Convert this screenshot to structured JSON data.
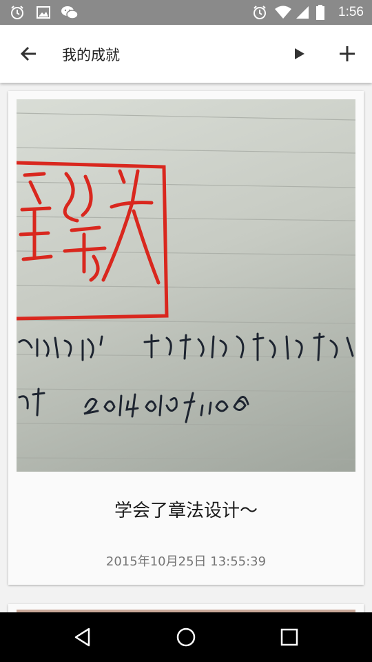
{
  "status_bar": {
    "time": "1:56",
    "left_icons": [
      "alarm-icon",
      "image-icon",
      "wechat-icon"
    ],
    "right_icons": [
      "alarm-icon",
      "wifi-icon",
      "signal-icon",
      "battery-icon"
    ]
  },
  "toolbar": {
    "title": "我的成就",
    "back_icon": "arrow-back-icon",
    "play_icon": "play-icon",
    "add_icon": "plus-icon"
  },
  "cards": [
    {
      "caption": "学会了章法设计～",
      "date": "2015年10月25日 13:55:39",
      "photo": {
        "handwritten_lines": [
          "妈私章”  注:少时因话多被老师赐号",
          "锐  20140109 11008"
        ]
      }
    }
  ],
  "nav_bar": {
    "icons": [
      "back-triangle-icon",
      "home-circle-icon",
      "recents-square-icon"
    ]
  },
  "colors": {
    "status_bar": "#8a8a8a",
    "toolbar": "#ffffff",
    "seal_red": "#d9271e",
    "ink": "#1d2430"
  }
}
